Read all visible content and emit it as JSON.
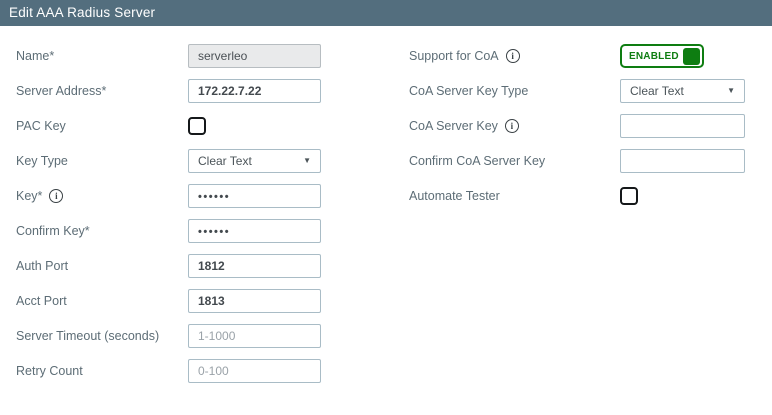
{
  "header": {
    "title": "Edit AAA Radius Server"
  },
  "icons": {
    "info": "i",
    "dropdown_arrow": "▼"
  },
  "colors": {
    "header_bg": "#536e7e",
    "toggle_green": "#0e7d11",
    "input_border": "#a9bcc6"
  },
  "form": {
    "left": [
      {
        "label": "Name*",
        "value": "serverleo"
      },
      {
        "label": "Server Address*",
        "value": "172.22.7.22"
      },
      {
        "label": "PAC Key",
        "checked": false
      },
      {
        "label": "Key Type",
        "value": "Clear Text"
      },
      {
        "label": "Key*",
        "value": "••••••"
      },
      {
        "label": "Confirm Key*",
        "value": "••••••"
      },
      {
        "label": "Auth Port",
        "value": "1812"
      },
      {
        "label": "Acct Port",
        "value": "1813"
      },
      {
        "label": "Server Timeout (seconds)",
        "placeholder": "1-1000"
      },
      {
        "label": "Retry Count",
        "placeholder": "0-100"
      }
    ],
    "right": [
      {
        "label": "Support for CoA",
        "value": "ENABLED"
      },
      {
        "label": "CoA Server Key Type",
        "value": "Clear Text"
      },
      {
        "label": "CoA Server Key",
        "value": ""
      },
      {
        "label": "Confirm CoA Server Key",
        "value": ""
      },
      {
        "label": "Automate Tester",
        "checked": false
      }
    ]
  }
}
